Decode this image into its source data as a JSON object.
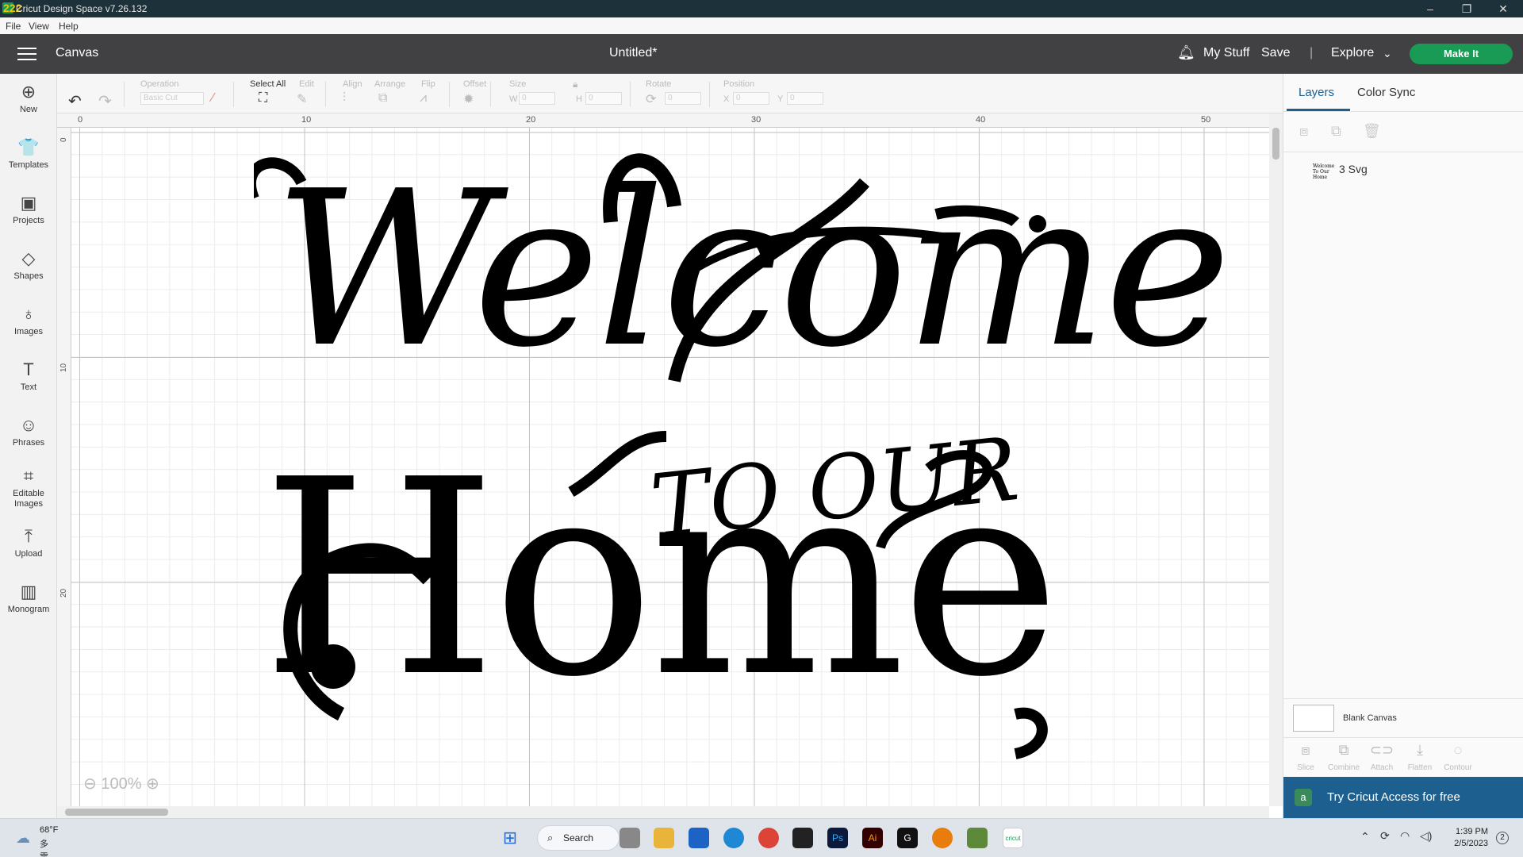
{
  "window": {
    "title": "Cricut Design Space  v7.26.132",
    "badge": "222",
    "minimize": "–",
    "restore": "❐",
    "close": "✕"
  },
  "menu": [
    "File",
    "View",
    "Help"
  ],
  "header": {
    "section": "Canvas",
    "doc_title": "Untitled*",
    "my_stuff": "My Stuff",
    "save": "Save",
    "divider": "|",
    "explore": "Explore",
    "make_it": "Make It"
  },
  "toolbar": {
    "operation_label": "Operation",
    "operation_value": "Basic Cut",
    "select_all": "Select All",
    "edit": "Edit",
    "align": "Align",
    "arrange": "Arrange",
    "flip": "Flip",
    "offset": "Offset",
    "size": "Size",
    "w_label": "W",
    "w_value": "0",
    "h_label": "H",
    "h_value": "0",
    "rotate": "Rotate",
    "rotate_value": "0",
    "position": "Position",
    "x_label": "X",
    "x_value": "0",
    "y_label": "Y",
    "y_value": "0"
  },
  "sidebar": [
    {
      "label": "New",
      "icon": "⊕"
    },
    {
      "label": "Templates",
      "icon": "👕"
    },
    {
      "label": "Projects",
      "icon": "▣"
    },
    {
      "label": "Shapes",
      "icon": "◇"
    },
    {
      "label": "Images",
      "icon": "♁"
    },
    {
      "label": "Text",
      "icon": "T"
    },
    {
      "label": "Phrases",
      "icon": "☺"
    },
    {
      "label": "Editable Images",
      "icon": "⌗"
    },
    {
      "label": "Upload",
      "icon": "⤒"
    },
    {
      "label": "Monogram",
      "icon": "▥"
    }
  ],
  "ruler": {
    "top": [
      "0",
      "10",
      "20",
      "30",
      "40",
      "50"
    ],
    "left": [
      "0",
      "10",
      "20"
    ]
  },
  "artwork": {
    "line1": "Welcome",
    "line2": "Home",
    "line3": "TO OUR"
  },
  "zoom": "100%",
  "panel": {
    "tab_layers": "Layers",
    "tab_color_sync": "Color Sync",
    "layer_name": "3 Svg",
    "layer_thumb": "Welcome To Our Home",
    "blank_canvas": "Blank Canvas",
    "ops": [
      "Slice",
      "Combine",
      "Attach",
      "Flatten",
      "Contour"
    ],
    "access": "Try Cricut Access for free"
  },
  "taskbar": {
    "temp": "68°F",
    "weather_desc": "多雲",
    "search": "Search",
    "time": "1:39 PM",
    "date": "2/5/2023",
    "notif": "2"
  }
}
